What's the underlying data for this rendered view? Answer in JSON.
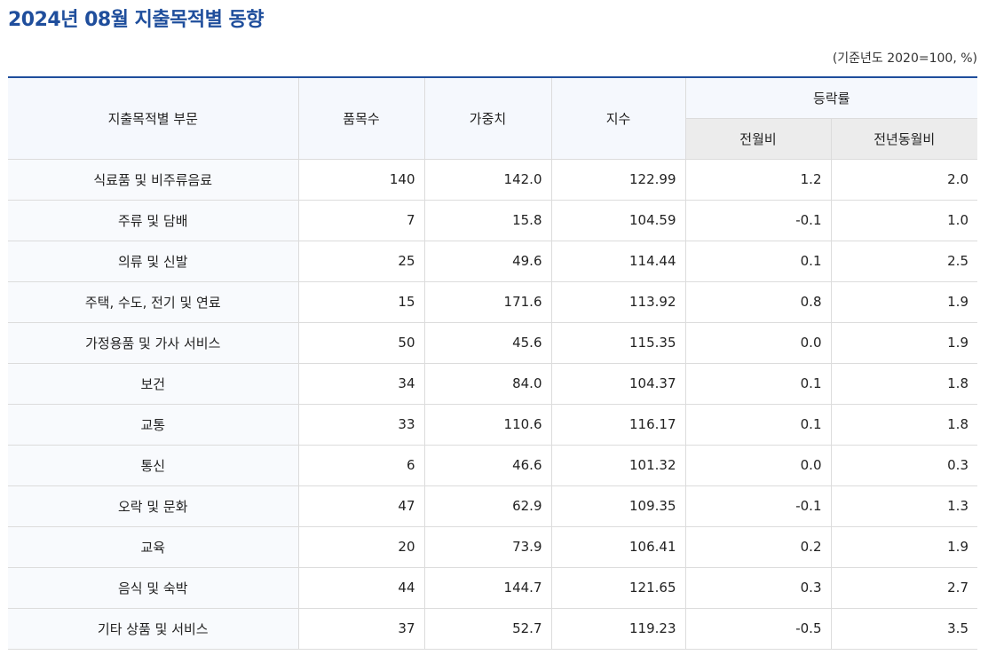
{
  "title": "2024년 08월 지출목적별 동향",
  "unit_note": "(기준년도 2020=100, %)",
  "headers": {
    "category": "지출목적별 부문",
    "items": "품목수",
    "weight": "가중치",
    "index": "지수",
    "change_rate": "등락률",
    "mom": "전월비",
    "yoy": "전년동월비"
  },
  "rows": [
    {
      "category": "식료품 및 비주류음료",
      "items": "140",
      "weight": "142.0",
      "index": "122.99",
      "mom": "1.2",
      "yoy": "2.0"
    },
    {
      "category": "주류 및 담배",
      "items": "7",
      "weight": "15.8",
      "index": "104.59",
      "mom": "-0.1",
      "yoy": "1.0"
    },
    {
      "category": "의류 및 신발",
      "items": "25",
      "weight": "49.6",
      "index": "114.44",
      "mom": "0.1",
      "yoy": "2.5"
    },
    {
      "category": "주택, 수도, 전기 및 연료",
      "items": "15",
      "weight": "171.6",
      "index": "113.92",
      "mom": "0.8",
      "yoy": "1.9"
    },
    {
      "category": "가정용품 및 가사 서비스",
      "items": "50",
      "weight": "45.6",
      "index": "115.35",
      "mom": "0.0",
      "yoy": "1.9"
    },
    {
      "category": "보건",
      "items": "34",
      "weight": "84.0",
      "index": "104.37",
      "mom": "0.1",
      "yoy": "1.8"
    },
    {
      "category": "교통",
      "items": "33",
      "weight": "110.6",
      "index": "116.17",
      "mom": "0.1",
      "yoy": "1.8"
    },
    {
      "category": "통신",
      "items": "6",
      "weight": "46.6",
      "index": "101.32",
      "mom": "0.0",
      "yoy": "0.3"
    },
    {
      "category": "오락 및 문화",
      "items": "47",
      "weight": "62.9",
      "index": "109.35",
      "mom": "-0.1",
      "yoy": "1.3"
    },
    {
      "category": "교육",
      "items": "20",
      "weight": "73.9",
      "index": "106.41",
      "mom": "0.2",
      "yoy": "1.9"
    },
    {
      "category": "음식 및 숙박",
      "items": "44",
      "weight": "144.7",
      "index": "121.65",
      "mom": "0.3",
      "yoy": "2.7"
    },
    {
      "category": "기타 상품 및 서비스",
      "items": "37",
      "weight": "52.7",
      "index": "119.23",
      "mom": "-0.5",
      "yoy": "3.5"
    }
  ],
  "colors": {
    "title": "#1f4e9c",
    "table_top_border": "#1f4e9c",
    "header_bg": "#f5f8fd",
    "subheader_bg": "#ececec",
    "grid": "#dcdcdc"
  }
}
